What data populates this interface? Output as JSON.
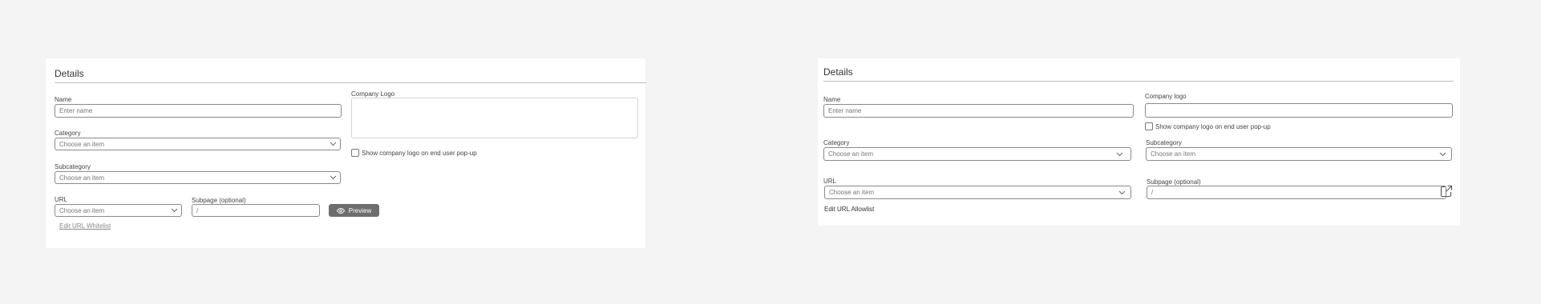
{
  "left": {
    "title": "Details",
    "name_label": "Name",
    "name_placeholder": "Enter name",
    "category_label": "Category",
    "category_value": "Choose an item",
    "subcategory_label": "Subcategory",
    "subcategory_value": "Choose an item",
    "url_label": "URL",
    "url_value": "Choose an item",
    "subpage_label": "Subpage (optional)",
    "subpage_value": "/",
    "preview_label": "Preview",
    "edit_link": "Edit URL Whitelist",
    "logo_label": "Company Logo",
    "show_logo_label": "Show company logo on end user pop-up"
  },
  "right": {
    "title": "Details",
    "name_label": "Name",
    "name_placeholder": "Enter name",
    "logo_label": "Company logo",
    "show_logo_label": "Show company logo on end user pop-up",
    "category_label": "Category",
    "category_value": "Choose an item",
    "subcategory_label": "Subcategory",
    "subcategory_value": "Choose an item",
    "url_label": "URL",
    "url_value": "Choose an item",
    "subpage_label": "Subpage (optional)",
    "subpage_value": "/",
    "edit_link": "Edit URL Allowlist"
  },
  "icons": {
    "dropdown": "chevron-down-icon",
    "preview": "eye-icon",
    "open": "external-link-icon"
  },
  "colors": {
    "background": "#f4f4f4",
    "panel": "#ffffff",
    "button": "#6e6e6e"
  }
}
